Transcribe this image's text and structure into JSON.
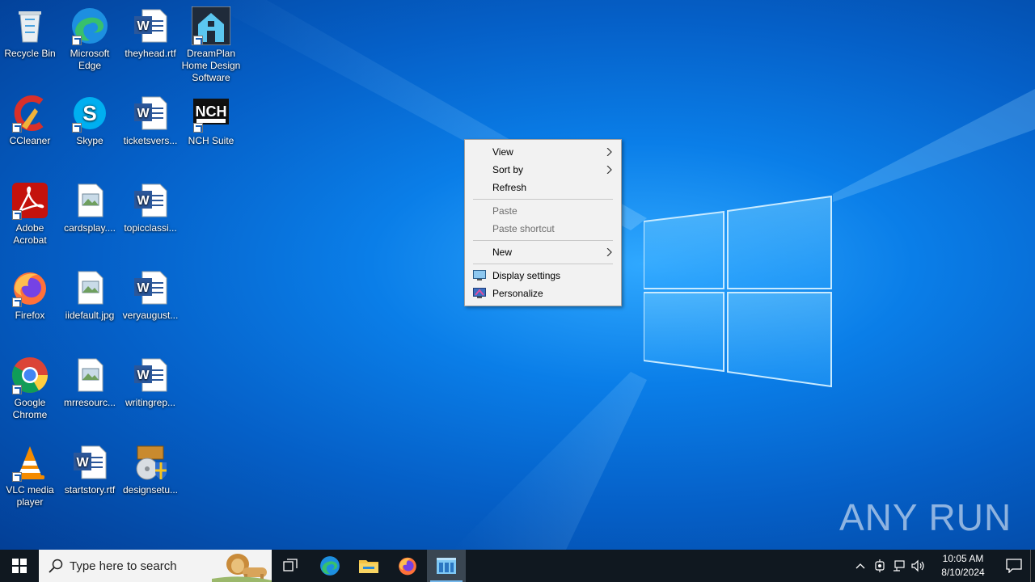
{
  "desktop": {
    "icons": [
      {
        "name": "recycle-bin",
        "label": "Recycle Bin"
      },
      {
        "name": "microsoft-edge",
        "label": "Microsoft Edge"
      },
      {
        "name": "theyhead",
        "label": "theyhead.rtf"
      },
      {
        "name": "dreamplan",
        "label": "DreamPlan Home Design Software"
      },
      {
        "name": "ccleaner",
        "label": "CCleaner"
      },
      {
        "name": "skype",
        "label": "Skype"
      },
      {
        "name": "ticketsvers",
        "label": "ticketsvers..."
      },
      {
        "name": "nch-suite",
        "label": "NCH Suite"
      },
      {
        "name": "adobe-acrobat",
        "label": "Adobe Acrobat"
      },
      {
        "name": "cardsplay",
        "label": "cardsplay...."
      },
      {
        "name": "topicclassi",
        "label": "topicclassi..."
      },
      {
        "name": "firefox",
        "label": "Firefox"
      },
      {
        "name": "iidefault",
        "label": "iidefault.jpg"
      },
      {
        "name": "veryaugust",
        "label": "veryaugust..."
      },
      {
        "name": "google-chrome",
        "label": "Google Chrome"
      },
      {
        "name": "mrresourc",
        "label": "mrresourc..."
      },
      {
        "name": "writingrep",
        "label": "writingrep..."
      },
      {
        "name": "vlc",
        "label": "VLC media player"
      },
      {
        "name": "startstory",
        "label": "startstory.rtf"
      },
      {
        "name": "designsetu",
        "label": "designsetu..."
      }
    ]
  },
  "context_menu": {
    "view": "View",
    "sort_by": "Sort by",
    "refresh": "Refresh",
    "paste": "Paste",
    "paste_shortcut": "Paste shortcut",
    "new": "New",
    "display_settings": "Display settings",
    "personalize": "Personalize"
  },
  "watermark": "ANY RUN",
  "taskbar": {
    "search_placeholder": "Type here to search",
    "time": "10:05 AM",
    "date": "8/10/2024"
  },
  "colors": {
    "taskbar": "#101820",
    "menu_bg": "#f2f2f2",
    "accent": "#76b9ed"
  }
}
